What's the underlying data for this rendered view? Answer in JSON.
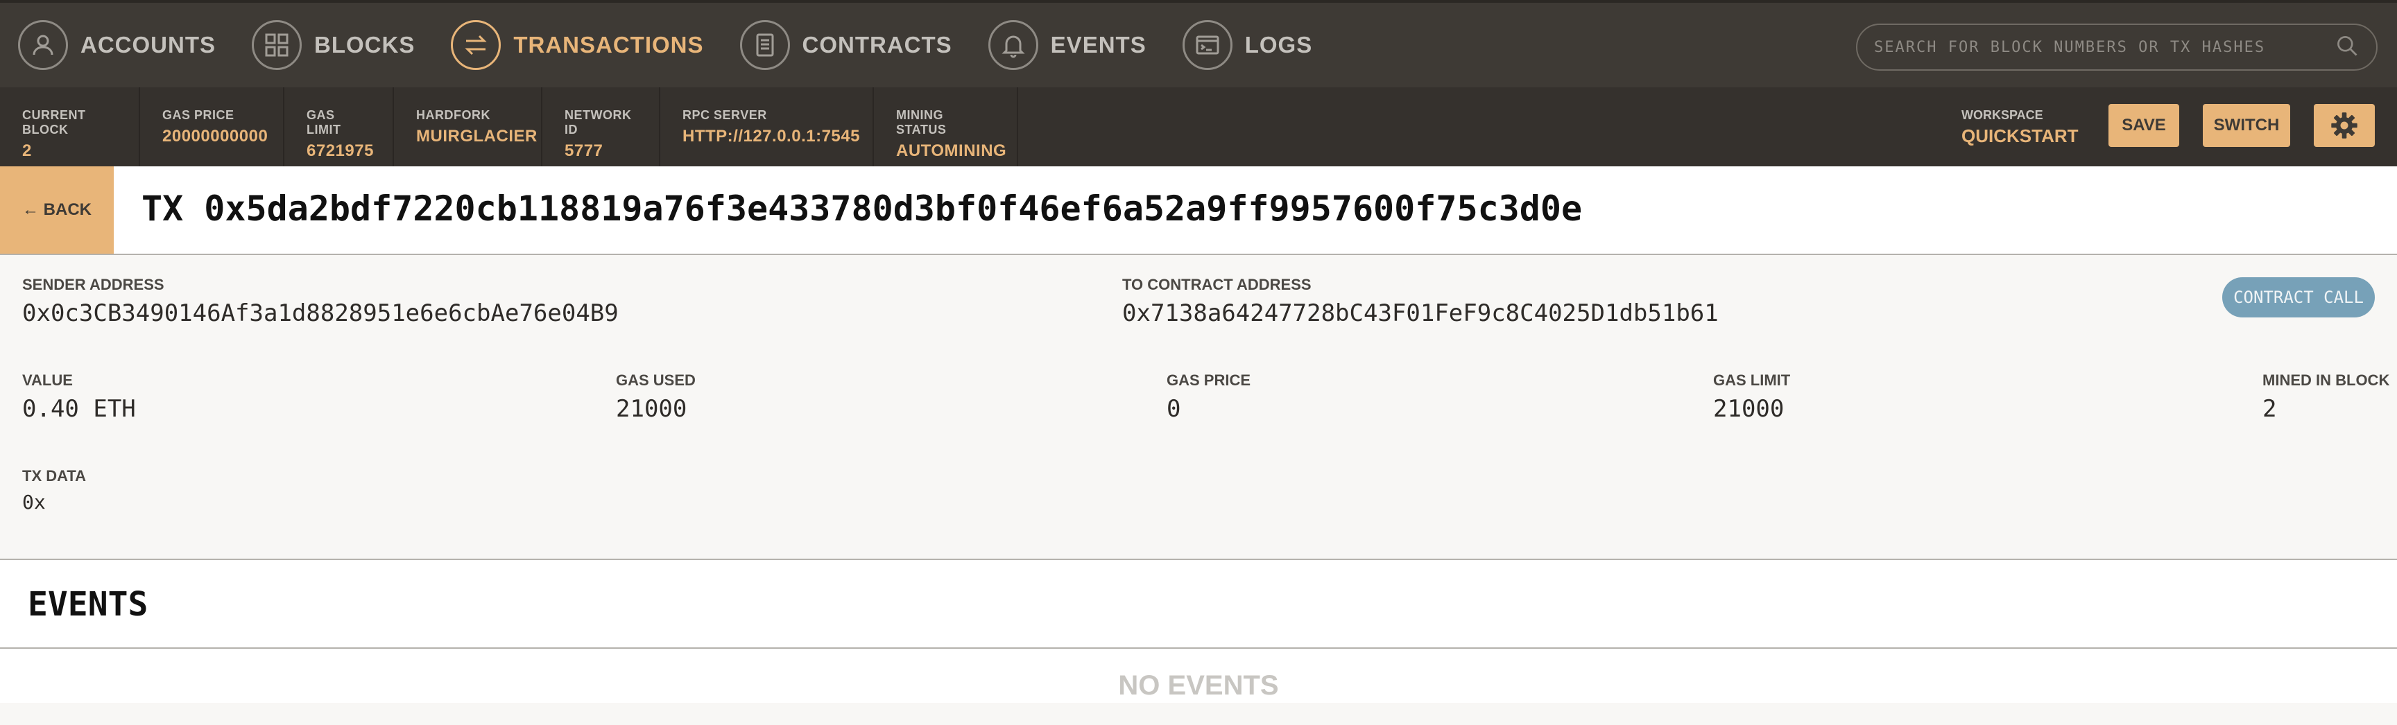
{
  "nav": {
    "items": [
      {
        "label": "ACCOUNTS",
        "icon": "user-icon"
      },
      {
        "label": "BLOCKS",
        "icon": "grid-icon"
      },
      {
        "label": "TRANSACTIONS",
        "icon": "swap-arrows-icon",
        "active": true
      },
      {
        "label": "CONTRACTS",
        "icon": "document-icon"
      },
      {
        "label": "EVENTS",
        "icon": "bell-icon"
      },
      {
        "label": "LOGS",
        "icon": "terminal-icon"
      }
    ],
    "search_placeholder": "SEARCH FOR BLOCK NUMBERS OR TX HASHES"
  },
  "status": {
    "current_block": {
      "label": "CURRENT BLOCK",
      "value": "2"
    },
    "gas_price": {
      "label": "GAS PRICE",
      "value": "20000000000"
    },
    "gas_limit": {
      "label": "GAS LIMIT",
      "value": "6721975"
    },
    "hardfork": {
      "label": "HARDFORK",
      "value": "MUIRGLACIER"
    },
    "network_id": {
      "label": "NETWORK ID",
      "value": "5777"
    },
    "rpc_server": {
      "label": "RPC SERVER",
      "value": "HTTP://127.0.0.1:7545"
    },
    "mining_status": {
      "label": "MINING STATUS",
      "value": "AUTOMINING"
    },
    "workspace": {
      "label": "WORKSPACE",
      "value": "QUICKSTART"
    },
    "save_label": "SAVE",
    "switch_label": "SWITCH"
  },
  "tx": {
    "back_label": "← BACK",
    "title": "TX 0x5da2bdf7220cb118819a76f3e433780d3bf0f46ef6a52a9ff9957600f75c3d0e",
    "badge": "CONTRACT CALL",
    "sender": {
      "label": "SENDER ADDRESS",
      "value": "0x0c3CB3490146Af3a1d8828951e6e6cbAe76e04B9"
    },
    "to": {
      "label": "TO CONTRACT ADDRESS",
      "value": "0x7138a64247728bC43F01FeF9c8C4025D1db51b61"
    },
    "value": {
      "label": "VALUE",
      "value": "0.40 ETH"
    },
    "gas_used": {
      "label": "GAS USED",
      "value": "21000"
    },
    "gas_price": {
      "label": "GAS PRICE",
      "value": "0"
    },
    "gas_limit": {
      "label": "GAS LIMIT",
      "value": "21000"
    },
    "mined_in_block": {
      "label": "MINED IN BLOCK",
      "value": "2"
    },
    "tx_data": {
      "label": "TX DATA",
      "value": "0x"
    }
  },
  "events": {
    "title": "EVENTS",
    "empty_label": "NO EVENTS"
  },
  "colors": {
    "accent": "#e8b579",
    "nav_bg": "#3e3a35",
    "status_bg": "#35312d",
    "badge": "#77a1b8"
  }
}
